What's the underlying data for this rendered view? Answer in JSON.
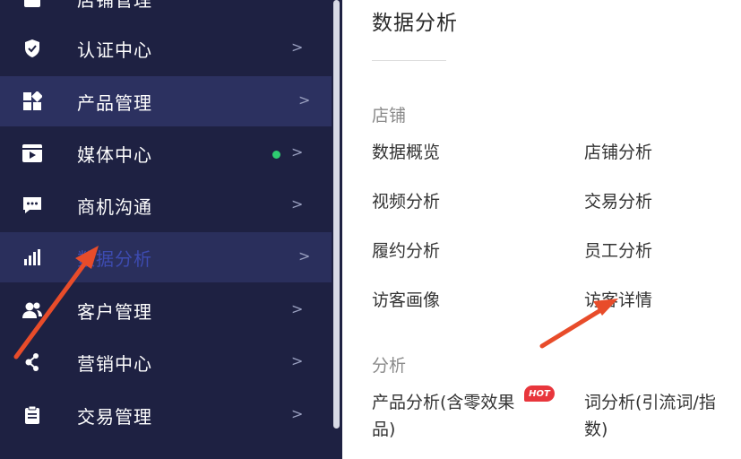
{
  "sidebar": {
    "items": [
      {
        "label": "店铺管理",
        "icon": "store-icon"
      },
      {
        "label": "认证中心",
        "icon": "shield-icon"
      },
      {
        "label": "产品管理",
        "icon": "product-blocks-icon"
      },
      {
        "label": "媒体中心",
        "icon": "video-icon",
        "badge": "green-dot"
      },
      {
        "label": "商机沟通",
        "icon": "chat-icon"
      },
      {
        "label": "数据分析",
        "icon": "bar-chart-icon"
      },
      {
        "label": "客户管理",
        "icon": "users-icon"
      },
      {
        "label": "营销中心",
        "icon": "share-nodes-icon"
      },
      {
        "label": "交易管理",
        "icon": "clipboard-icon"
      }
    ],
    "chevron": ">"
  },
  "panel": {
    "title": "数据分析",
    "section_store": "店铺",
    "store_links": [
      "数据概览",
      "店铺分析",
      "视频分析",
      "交易分析",
      "履约分析",
      "员工分析",
      "访客画像",
      "访客详情"
    ],
    "section_analysis": "分析",
    "analysis_links": [
      "产品分析(含零效果品)",
      "词分析(引流词/指数)"
    ],
    "hot_badge": "HOT"
  },
  "colors": {
    "sidebar_bg": "#1e2142",
    "active_bg": "#2c3160",
    "dot": "#2ecc71",
    "arrow": "#e84c2a",
    "hot": "#e8363c"
  }
}
